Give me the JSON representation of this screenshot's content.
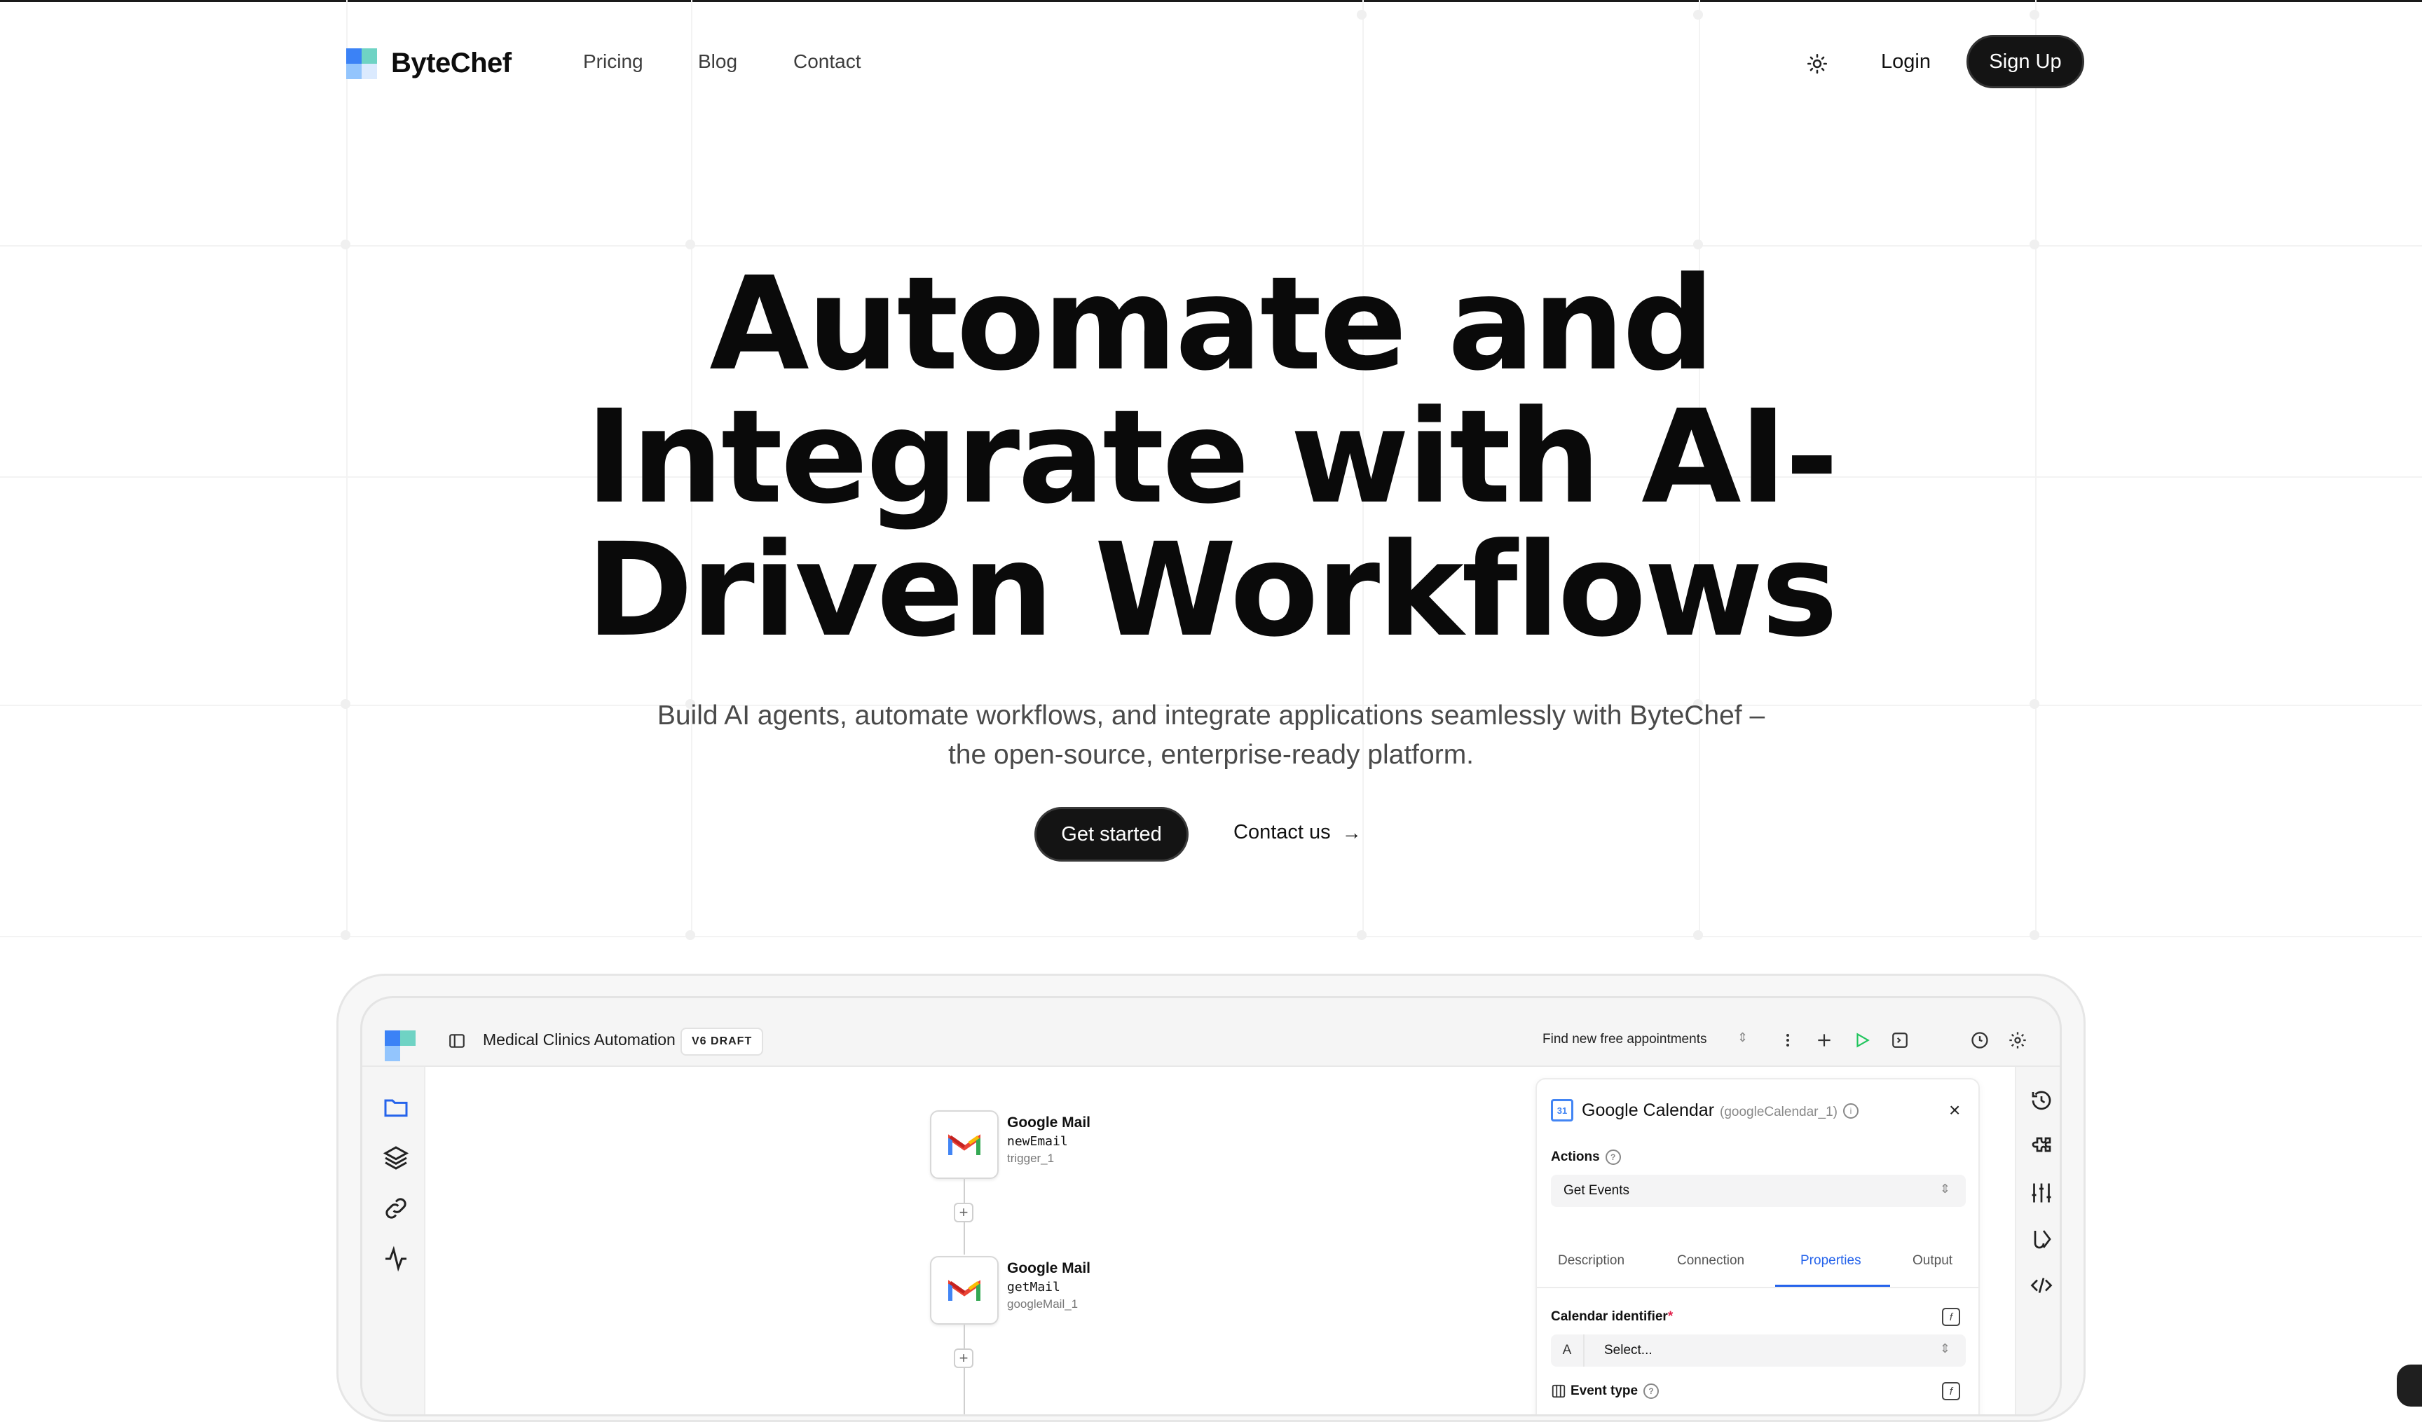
{
  "brand": {
    "name": "ByteChef"
  },
  "nav": {
    "links": [
      "Pricing",
      "Blog",
      "Contact"
    ],
    "login": "Login",
    "signup": "Sign Up",
    "theme_icon": "sun-icon"
  },
  "hero": {
    "title": "Automate and Integrate with AI-Driven Workflows",
    "subtitle": "Build AI agents, automate workflows, and integrate applications seamlessly with ByteChef – the open-source, enterprise-ready platform.",
    "cta_primary": "Get started",
    "cta_secondary": "Contact us"
  },
  "app": {
    "workflow_name": "Medical Clinics Automation",
    "version_badge": "V6 DRAFT",
    "workflow_select": "Find new free appointments",
    "nodes": [
      {
        "title": "Google Mail",
        "operation": "newEmail",
        "id": "trigger_1"
      },
      {
        "title": "Google Mail",
        "operation": "getMail",
        "id": "googleMail_1"
      }
    ],
    "panel": {
      "title": "Google Calendar",
      "title_id": "(googleCalendar_1)",
      "actions_label": "Actions",
      "actions_value": "Get Events",
      "tabs": [
        "Description",
        "Connection",
        "Properties",
        "Output"
      ],
      "active_tab": "Properties",
      "calendar_identifier_label": "Calendar identifier",
      "calendar_identifier_prefix": "A",
      "calendar_identifier_placeholder": "Select...",
      "event_type_label": "Event type"
    }
  },
  "colors": {
    "primary_button": "#141414",
    "accent": "#2563eb",
    "required": "#e11d48"
  }
}
